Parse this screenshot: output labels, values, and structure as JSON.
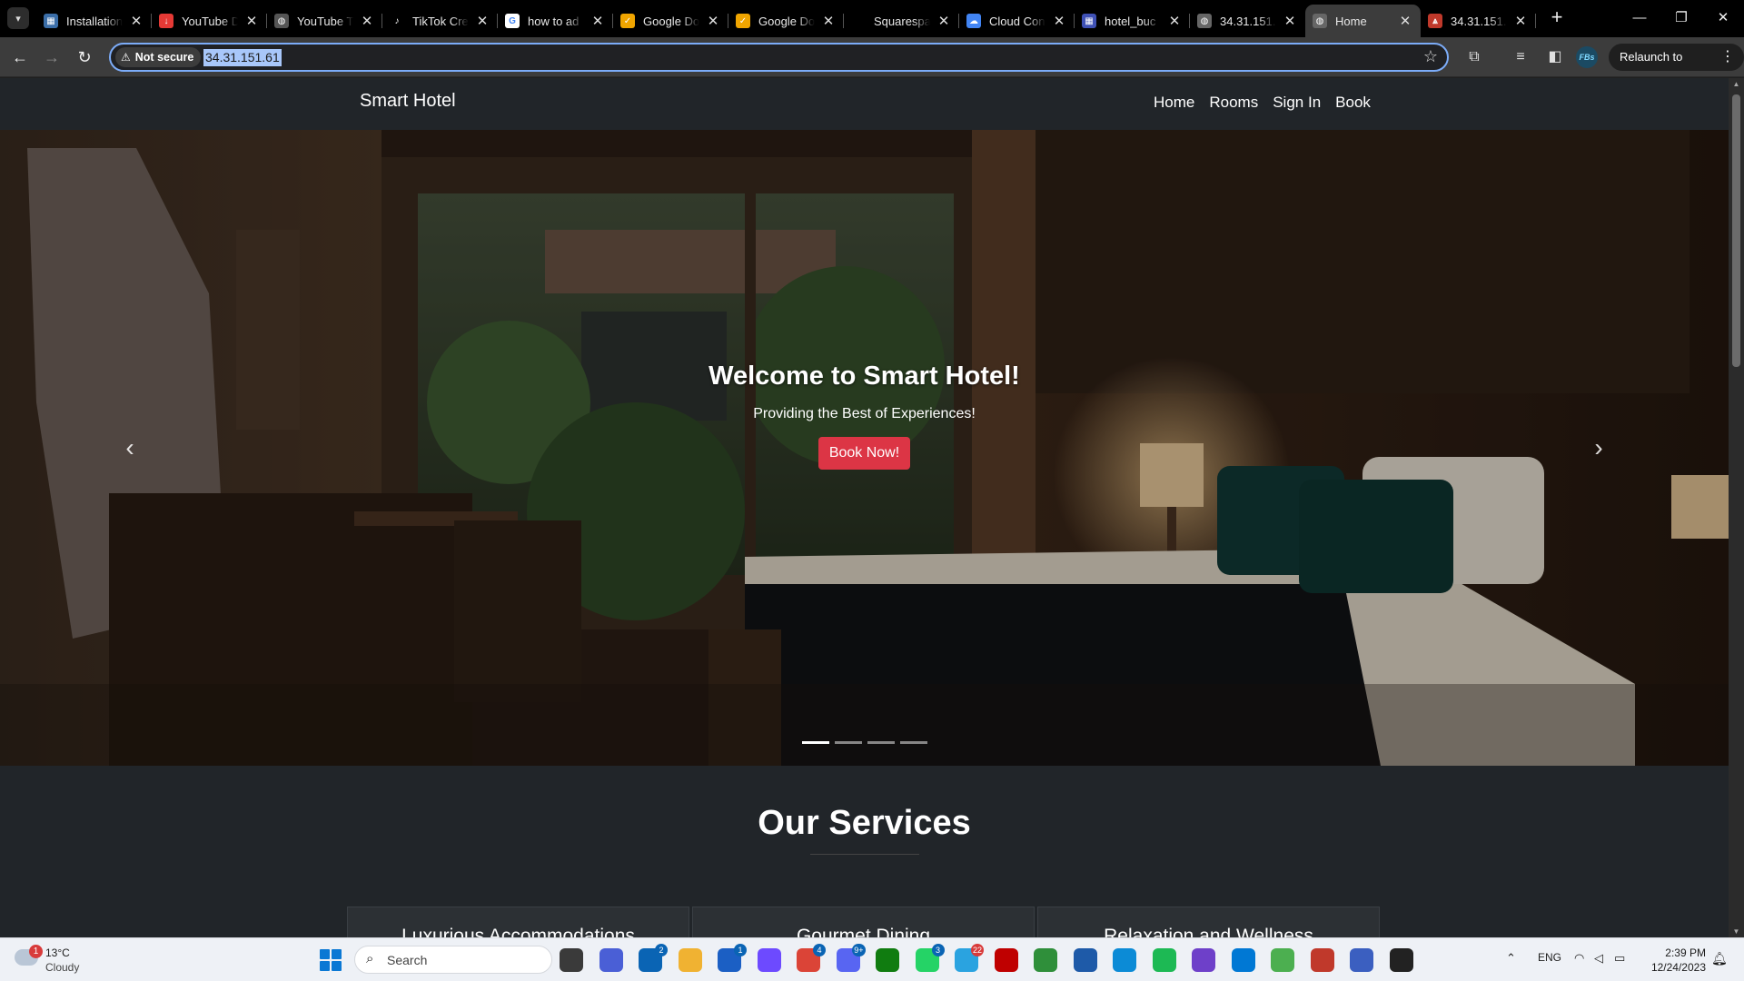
{
  "browser": {
    "tabs": [
      {
        "title": "Installation",
        "favicon_color": "#3b6ea8",
        "favicon_glyph": "▦"
      },
      {
        "title": "YouTube D",
        "favicon_color": "#e53935",
        "favicon_glyph": "↓"
      },
      {
        "title": "YouTube T",
        "favicon_color": "#555555",
        "favicon_glyph": "◍"
      },
      {
        "title": "TikTok Cre",
        "favicon_color": "#000000",
        "favicon_glyph": "♪"
      },
      {
        "title": "how to ad",
        "favicon_color": "#ffffff",
        "favicon_glyph": "G"
      },
      {
        "title": "Google Do",
        "favicon_color": "#f0a500",
        "favicon_glyph": "✓"
      },
      {
        "title": "Google Do",
        "favicon_color": "#f0a500",
        "favicon_glyph": "✓"
      },
      {
        "title": "Squarespa",
        "favicon_color": "#000000",
        "favicon_glyph": ""
      },
      {
        "title": "Cloud Con",
        "favicon_color": "#4285f4",
        "favicon_glyph": "☁"
      },
      {
        "title": "hotel_buc",
        "favicon_color": "#3f51b5",
        "favicon_glyph": "▦"
      },
      {
        "title": "34.31.151.",
        "favicon_color": "#666666",
        "favicon_glyph": "◍"
      },
      {
        "title": "Home",
        "favicon_color": "#666666",
        "favicon_glyph": "◍",
        "active": true
      },
      {
        "title": "34.31.151.",
        "favicon_color": "#c0392b",
        "favicon_glyph": "⩓"
      }
    ],
    "security_label": "Not secure",
    "url": "34.31.151.61",
    "profile_initials": "FBs",
    "relaunch_label": "Relaunch to update"
  },
  "site": {
    "brand": "Smart Hotel",
    "nav": [
      "Home",
      "Rooms",
      "Sign In",
      "Book"
    ],
    "hero": {
      "title": "Welcome to Smart Hotel!",
      "subtitle": "Providing the Best of Experiences!",
      "cta_label": "Book Now!",
      "cta_color": "#dc3545",
      "slide_count": 4,
      "active_slide": 1
    },
    "services": {
      "heading": "Our Services",
      "cards": [
        "Luxurious Accommodations",
        "Gourmet Dining",
        "Relaxation and Wellness"
      ]
    }
  },
  "taskbar": {
    "weather_temp": "13°C",
    "weather_cond": "Cloudy",
    "weather_badge": "1",
    "search_placeholder": "Search",
    "language": "ENG",
    "time": "2:39 PM",
    "date": "12/24/2023",
    "apps": [
      {
        "name": "file-explorer",
        "color": "#3a3a3a",
        "badge": ""
      },
      {
        "name": "zoom",
        "color": "#4a5fd6",
        "badge": ""
      },
      {
        "name": "mail",
        "color": "#0a64b4",
        "badge": "2"
      },
      {
        "name": "folder",
        "color": "#f0b232",
        "badge": ""
      },
      {
        "name": "store",
        "color": "#1b5fc4",
        "badge": "1"
      },
      {
        "name": "proton",
        "color": "#6d4aff",
        "badge": ""
      },
      {
        "name": "chrome",
        "color": "#db4437",
        "badge": "4"
      },
      {
        "name": "discord",
        "color": "#5865f2",
        "badge": "9+"
      },
      {
        "name": "xbox",
        "color": "#107c10",
        "badge": ""
      },
      {
        "name": "whatsapp",
        "color": "#25d366",
        "badge": "3"
      },
      {
        "name": "telegram",
        "color": "#2aa3e0",
        "badge": "22"
      },
      {
        "name": "filezilla",
        "color": "#bf0000",
        "badge": ""
      },
      {
        "name": "globe",
        "color": "#2f8f3a",
        "badge": ""
      },
      {
        "name": "notepad",
        "color": "#1e5aa8",
        "badge": ""
      },
      {
        "name": "edge",
        "color": "#0c8bd6",
        "badge": ""
      },
      {
        "name": "spotify",
        "color": "#1db954",
        "badge": ""
      },
      {
        "name": "github",
        "color": "#6e40c9",
        "badge": ""
      },
      {
        "name": "vscode",
        "color": "#0078d4",
        "badge": ""
      },
      {
        "name": "ring",
        "color": "#4caf50",
        "badge": ""
      },
      {
        "name": "dbeaver",
        "color": "#c0392b",
        "badge": ""
      },
      {
        "name": "settings",
        "color": "#3b5fc0",
        "badge": ""
      },
      {
        "name": "terminal",
        "color": "#222222",
        "badge": ""
      }
    ]
  }
}
